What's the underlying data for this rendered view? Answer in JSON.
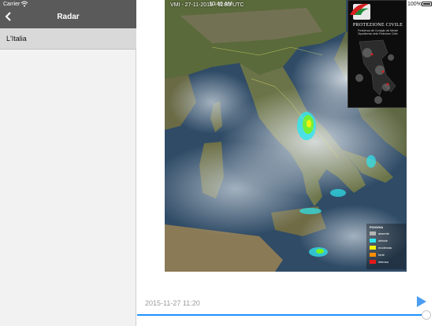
{
  "status_bar": {
    "carrier": "Carrier",
    "time": "10:40 AM",
    "battery": "100%",
    "wifi_icon": "wifi-icon",
    "battery_icon": "battery-icon"
  },
  "sidebar": {
    "title": "Radar",
    "back_icon": "chevron-left-icon",
    "items": [
      {
        "label": "L'Italia",
        "selected": true
      }
    ]
  },
  "radar": {
    "caption": "VMI - 27-11-2015 - 11:20 UTC",
    "logo": {
      "title": "PROTEZIONE CIVILE",
      "subtitle": "Presidenza del Consiglio dei Ministri Dipartimento della Protezione Civile"
    },
    "legend": {
      "title": "PIOGGIA",
      "entries": [
        {
          "label": "assente",
          "color": "#b5b5b5"
        },
        {
          "label": "debole",
          "color": "#2de6f0"
        },
        {
          "label": "moderata",
          "color": "#f2f20c"
        },
        {
          "label": "forte",
          "color": "#ff8c00"
        },
        {
          "label": "intensa",
          "color": "#e51919"
        }
      ]
    }
  },
  "footer": {
    "timestamp": "2015-11-27 11:20",
    "play_icon": "play-icon",
    "progress": 1.0,
    "accent_color": "#1e90ff"
  }
}
